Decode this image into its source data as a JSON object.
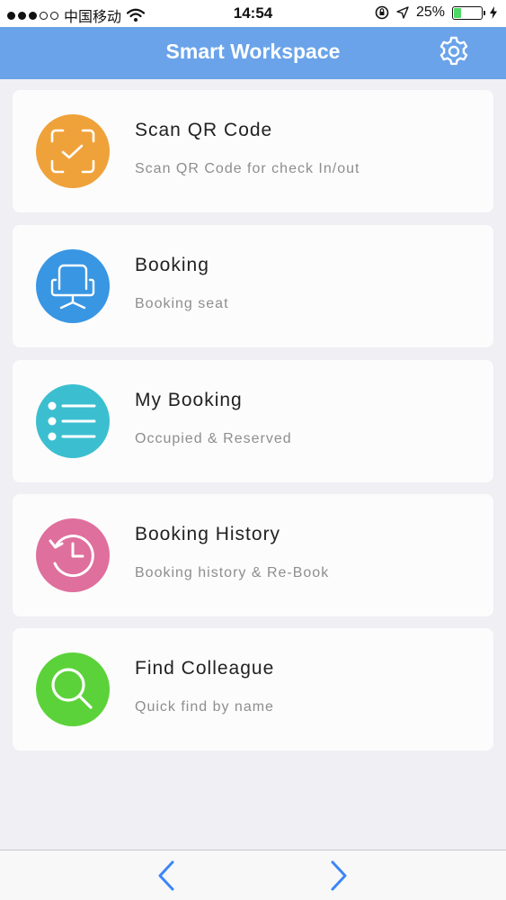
{
  "status_bar": {
    "carrier": "中国移动",
    "time": "14:54",
    "battery": "25%",
    "battery_level": 0.25,
    "signal_dots": 5,
    "signal_filled": 3
  },
  "nav": {
    "title": "Smart Workspace",
    "settings_icon": "gear-icon"
  },
  "menu": [
    {
      "title": "Scan QR Code",
      "subtitle": "Scan QR Code for check In/out",
      "color": "#efa23a",
      "icon": "qr-scan-icon"
    },
    {
      "title": "Booking",
      "subtitle": "Booking seat",
      "color": "#3896e3",
      "icon": "chair-icon"
    },
    {
      "title": "My Booking",
      "subtitle": "Occupied & Reserved",
      "color": "#3bbfd0",
      "icon": "list-icon"
    },
    {
      "title": "Booking History",
      "subtitle": "Booking history & Re-Book",
      "color": "#df6f9d",
      "icon": "history-icon"
    },
    {
      "title": "Find Colleague",
      "subtitle": "Quick find by name",
      "color": "#5cd23a",
      "icon": "search-icon"
    }
  ],
  "toolbar": {
    "back_icon": "chevron-left-icon",
    "forward_icon": "chevron-right-icon",
    "accent": "#3a86f7"
  }
}
